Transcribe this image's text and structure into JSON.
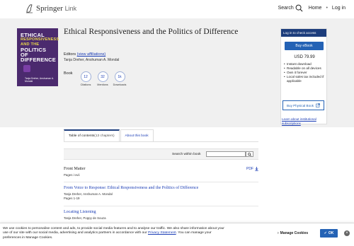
{
  "header": {
    "brand": "Springer",
    "brand_sub": "Link",
    "search_label": "Search",
    "home_label": "Home",
    "login_label": "Log in"
  },
  "cover": {
    "line1": "Ethical",
    "line2": "Responsiveness",
    "line3": "and the",
    "line4": "Politics of",
    "line5": "Difference",
    "editors": "Tanja Dreher, Anshuman A. Mondal"
  },
  "book": {
    "title": "Ethical Responsiveness and the Politics of Difference",
    "editors_label": "Editors",
    "affiliations_link": "(view affiliations)",
    "authors": "Tanja Dreher, Anshuman A. Mondal",
    "type": "Book",
    "metrics": [
      {
        "value": "12",
        "label": "Citations"
      },
      {
        "value": "32",
        "label": "Mentions"
      },
      {
        "value": "1k",
        "label": "Downloads"
      }
    ]
  },
  "purchase": {
    "header": "Log in to check access",
    "ebook_label": "Buy eBook",
    "price": "USD 79.99",
    "features": [
      "Instant download",
      "Readable on all devices",
      "Own it forever",
      "Local sales tax included if applicable"
    ],
    "physical_label": "Buy Physical Book",
    "institutional_link": "Learn about institutional subscriptions"
  },
  "tabs": {
    "toc_label": "Table of contents",
    "toc_count": " (13 chapters)",
    "about_label": "About this book"
  },
  "toc": {
    "search_label": "Search within book",
    "search_placeholder": "",
    "items": [
      {
        "title": "Front Matter",
        "meta": "Pages i-xvii",
        "pdf": "PDF"
      },
      {
        "title": "From Voice to Response: Ethical Responsiveness and the Politics of Difference",
        "authors": "Tanja Dreher, Anshuman A. Mondal",
        "meta": "Pages 1-19"
      },
      {
        "title": "Locating Listening",
        "authors": "Tanja Dreher, Poppy de Souza",
        "meta": ""
      }
    ]
  },
  "cookie": {
    "text_part1": "We use cookies to personalise content and ads, to provide social media features and to analyse our traffic. We also share information about your use of our site with our social media, advertising and analytics partners in accordance with our ",
    "privacy_link": "Privacy Statement",
    "text_part2": ". You can manage your preferences in Manage Cookies.",
    "manage_label": "Manage Cookies",
    "ok_label": "OK"
  },
  "colors": {
    "brand_blue": "#1d3d7c",
    "link_blue": "#1a3cb5",
    "button_blue": "#2462b5",
    "cover_purple": "#4b2a6e"
  }
}
